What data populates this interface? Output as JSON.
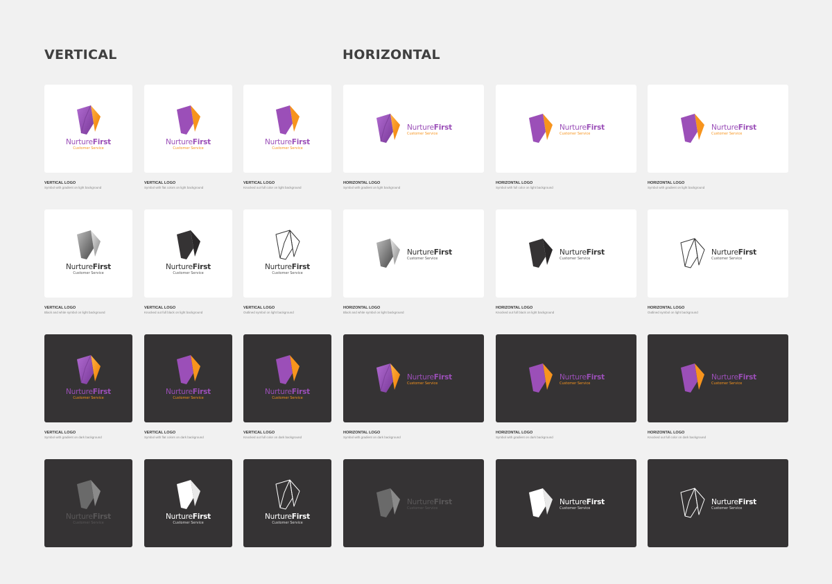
{
  "sections": {
    "vertical": "VERTICAL",
    "horizontal": "HORIZONTAL"
  },
  "logo": {
    "word1": "Nurture",
    "word2": "First",
    "tagline": "Customer Service"
  },
  "colors": {
    "purple": "#9b4fb8",
    "orange": "#f7941d",
    "dark_card": "#353334",
    "light_card": "#ffffff",
    "page": "#f1f1f1"
  },
  "rows": [
    {
      "bg": "light",
      "cards": [
        {
          "style": "gradient",
          "title": "VERTICAL LOGO",
          "desc": "Symbol with gradient on light background"
        },
        {
          "style": "flat",
          "title": "VERTICAL LOGO",
          "desc": "Symbol with flat colors on light background"
        },
        {
          "style": "flat",
          "title": "VERTICAL LOGO",
          "desc": "Knocked out full color on light background"
        },
        {
          "style": "gradient",
          "title": "HORIZONTAL LOGO",
          "desc": "Symbol with gradient on light background"
        },
        {
          "style": "flat",
          "title": "HORIZONTAL LOGO",
          "desc": "Symbol with full color on light background"
        },
        {
          "style": "flat",
          "title": "HORIZONTAL LOGO",
          "desc": "Symbol with gradient on light background"
        }
      ]
    },
    {
      "bg": "light",
      "cards": [
        {
          "style": "grayscale",
          "title": "VERTICAL LOGO",
          "desc": "Black and white symbol on light background"
        },
        {
          "style": "solid",
          "title": "VERTICAL LOGO",
          "desc": "Knocked out full black on light background"
        },
        {
          "style": "outline",
          "title": "VERTICAL LOGO",
          "desc": "Outlined symbol on light background"
        },
        {
          "style": "grayscale",
          "title": "HORIZONTAL LOGO",
          "desc": "Black and white symbol on light background"
        },
        {
          "style": "solid",
          "title": "HORIZONTAL LOGO",
          "desc": "Knocked out full black on light background"
        },
        {
          "style": "outline",
          "title": "HORIZONTAL LOGO",
          "desc": "Outlined symbol on light background"
        }
      ]
    },
    {
      "bg": "dark",
      "cards": [
        {
          "style": "gradient",
          "title": "VERTICAL LOGO",
          "desc": "Symbol with gradient on dark background"
        },
        {
          "style": "flat",
          "title": "VERTICAL LOGO",
          "desc": "Symbol with flat colors on dark background"
        },
        {
          "style": "flat",
          "title": "VERTICAL LOGO",
          "desc": "Knocked out full color on dark background"
        },
        {
          "style": "gradient",
          "title": "HORIZONTAL LOGO",
          "desc": "Symbol with gradient on dark background"
        },
        {
          "style": "flat",
          "title": "HORIZONTAL LOGO",
          "desc": "Symbol with gradient on dark background"
        },
        {
          "style": "flat",
          "title": "HORIZONTAL LOGO",
          "desc": "Knocked out full color on dark background"
        }
      ]
    },
    {
      "bg": "dark",
      "cards": [
        {
          "style": "grayscale",
          "title": "",
          "desc": ""
        },
        {
          "style": "solid",
          "title": "",
          "desc": ""
        },
        {
          "style": "outline",
          "title": "",
          "desc": ""
        },
        {
          "style": "grayscale",
          "title": "",
          "desc": ""
        },
        {
          "style": "solid",
          "title": "",
          "desc": ""
        },
        {
          "style": "outline",
          "title": "",
          "desc": ""
        }
      ]
    }
  ]
}
